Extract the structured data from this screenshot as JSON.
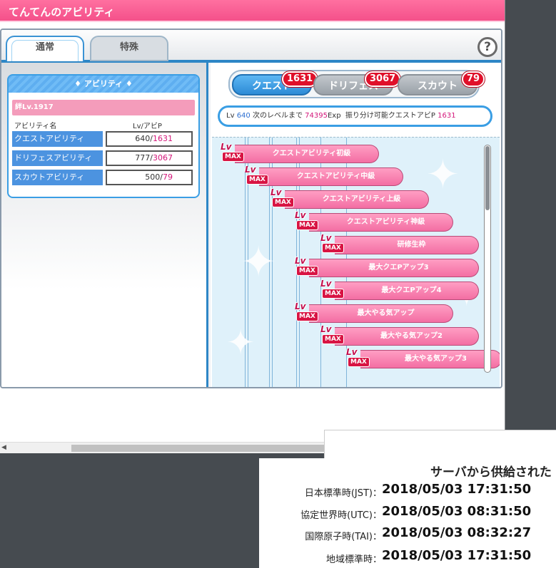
{
  "window": {
    "title": "てんてんのアビリティ"
  },
  "tabs": {
    "normal": "通常",
    "special": "特殊",
    "help": "?"
  },
  "ability": {
    "header": "♦ アビリティ ♦",
    "rank": "絆Lv.1917",
    "col_name": "アビリティ名",
    "col_value": "Lv/アビP",
    "rows": [
      {
        "name": "クエストアビリティ",
        "lv": "640/",
        "ap": "1631"
      },
      {
        "name": "ドリフェスアビリティ",
        "lv": "777/",
        "ap": "3067"
      },
      {
        "name": "スカウトアビリティ",
        "lv": "500/",
        "ap": "79"
      }
    ]
  },
  "subtabs": [
    {
      "label": "クエスト",
      "badge": "1631"
    },
    {
      "label": "ドリフェス",
      "badge": "3067"
    },
    {
      "label": "スカウト",
      "badge": "79"
    }
  ],
  "info": {
    "lv_label": "Lv",
    "lv": "640",
    "next_label": "次のレベルまで",
    "exp": "74395",
    "exp_unit": "Exp",
    "alloc_label": "振り分け可能クエストアビP",
    "alloc": "1631"
  },
  "tree": {
    "lv_text": "Lv",
    "max_text": "MAX",
    "nodes": [
      "クエストアビリティ初級",
      "クエストアビリティ中級",
      "クエストアビリティ上級",
      "クエストアビリティ神級",
      "研修生枠",
      "最大クエPアップ3",
      "最大クエPアップ4",
      "最大やる気アップ",
      "最大やる気アップ2",
      "最大やる気アップ3"
    ]
  },
  "clock": {
    "title": "サーバから供給された",
    "rows": [
      {
        "label": "日本標準時(JST)：",
        "value": "2018/05/03 17:31:50"
      },
      {
        "label": "協定世界時(UTC)：",
        "value": "2018/05/03 08:31:50"
      },
      {
        "label": "国際原子時(TAI)：",
        "value": "2018/05/03 08:32:27"
      },
      {
        "label": "地域標準時：",
        "value": "2018/05/03 17:31:50"
      }
    ]
  },
  "colors": {
    "accent_pink": "#f4508a",
    "accent_blue": "#2d86c6",
    "badge_red": "#e0102a"
  }
}
